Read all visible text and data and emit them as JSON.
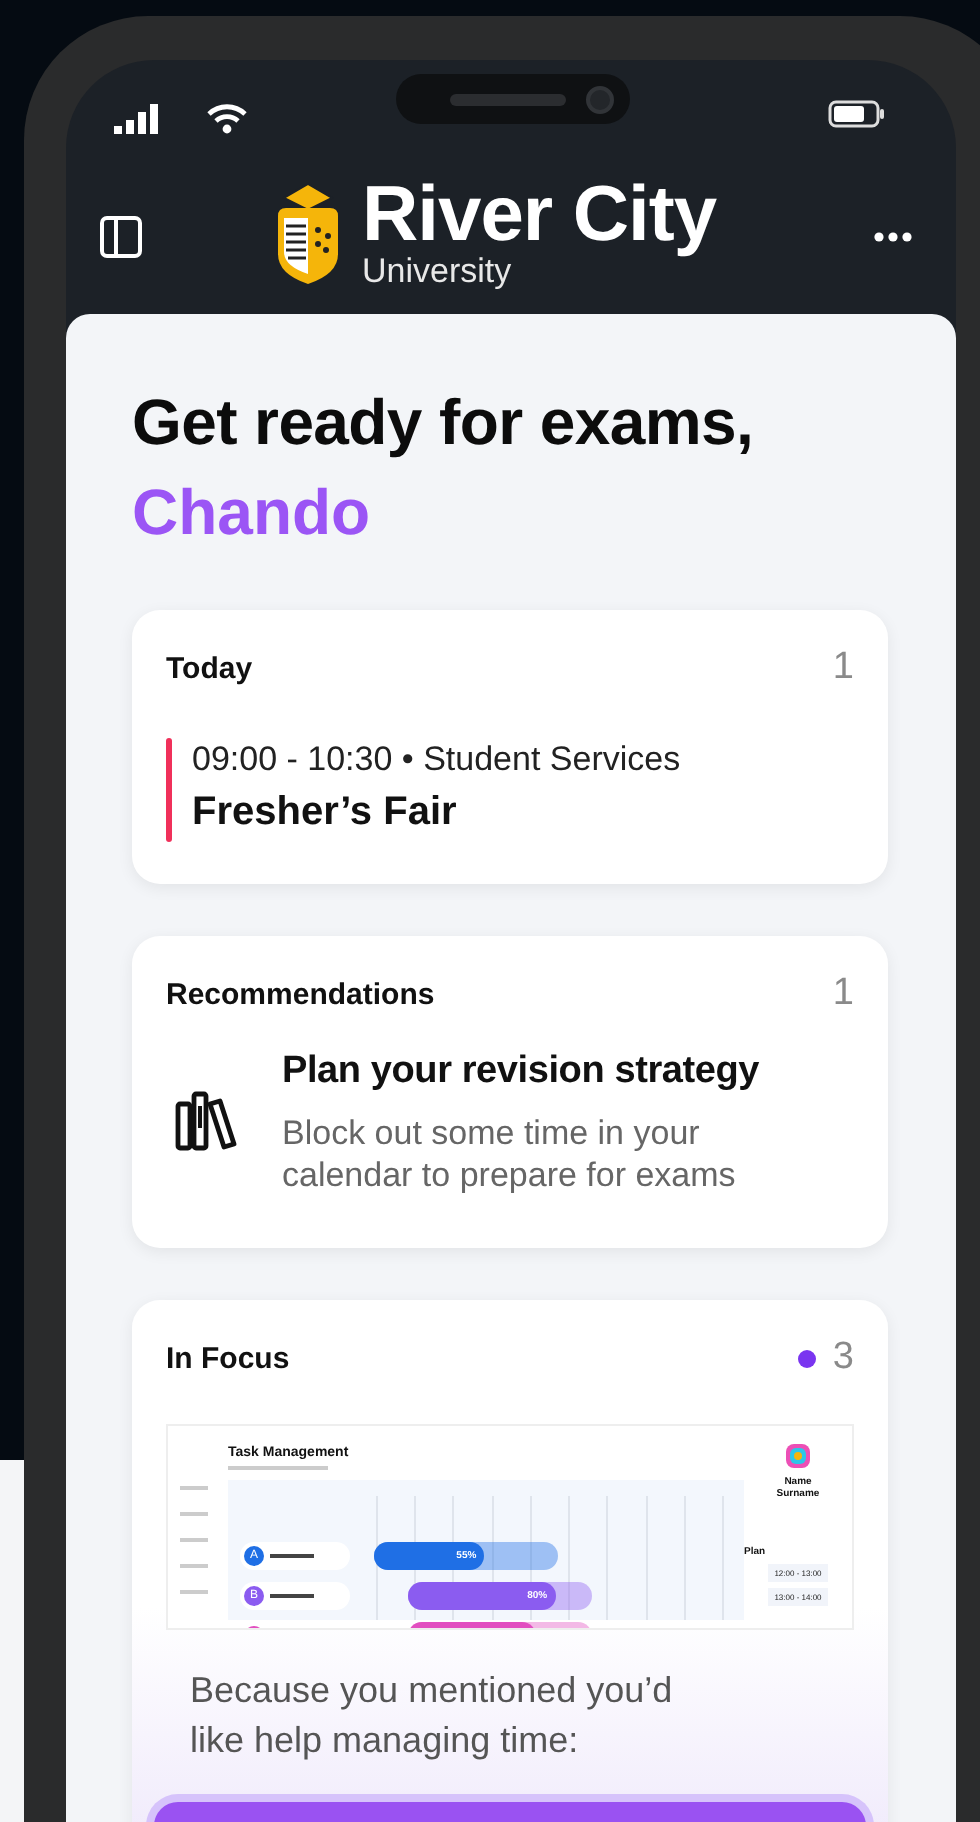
{
  "header": {
    "logo_title": "River City",
    "logo_subtitle": "University"
  },
  "greeting": {
    "line": "Get ready for exams,",
    "name": "Chando"
  },
  "cards": [
    {
      "kind": "today",
      "title": "Today",
      "count": "1",
      "events": [
        {
          "time": "09:00 - 10:30 • Student Services",
          "title": "Fresher’s Fair",
          "color": "#f0305a"
        }
      ]
    },
    {
      "kind": "recommendations",
      "title": "Recommendations",
      "count": "1",
      "items": [
        {
          "title": "Plan your revision strategy",
          "text": "Block out some time in your calendar to prepare for exams"
        }
      ]
    },
    {
      "kind": "focus",
      "title": "In Focus",
      "count": "3",
      "preview": {
        "title": "Task Management",
        "profile_name": "Name Surname",
        "plan_label": "Plan",
        "tasks": [
          {
            "badge": "A",
            "percent": "55%",
            "level": 0.6,
            "color": "#1f6fe5"
          },
          {
            "badge": "B",
            "percent": "80%",
            "level": 0.8,
            "color": "#8b5cf0"
          },
          {
            "level": 0.7,
            "color": "#e24fc0"
          }
        ],
        "plan": [
          {
            "time": "12:00 - 13:00"
          },
          {
            "time": "13:00 - 14:00"
          }
        ]
      },
      "text": "Because you mentioned you’d like help managing time:"
    }
  ]
}
